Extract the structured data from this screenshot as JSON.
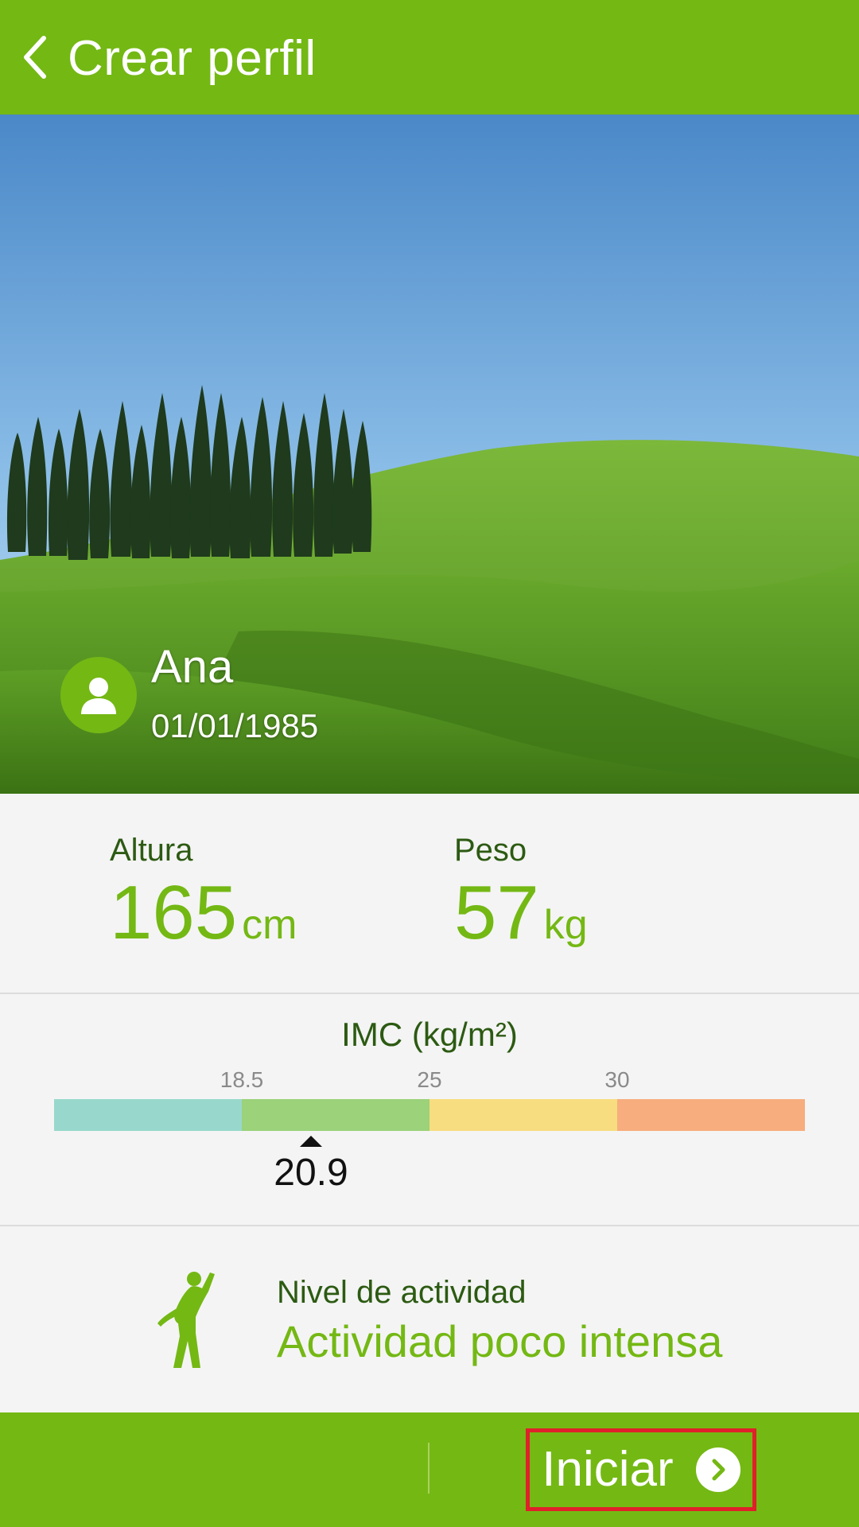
{
  "header": {
    "title": "Crear perfil",
    "back_icon": "chevron-left-icon"
  },
  "profile": {
    "name": "Ana",
    "birthdate": "01/01/1985",
    "avatar_icon": "user-silhouette-icon"
  },
  "measurements": {
    "height": {
      "label": "Altura",
      "value": "165",
      "unit": "cm"
    },
    "weight": {
      "label": "Peso",
      "value": "57",
      "unit": "kg"
    }
  },
  "bmi": {
    "title": "IMC (kg/m²)",
    "ticks": [
      "18.5",
      "25",
      "30"
    ],
    "value": "20.9",
    "segment_colors": [
      "#98d8cc",
      "#9bd27a",
      "#f7dd80",
      "#f7ad7e"
    ]
  },
  "activity": {
    "label": "Nivel de actividad",
    "value": "Actividad poco intensa",
    "icon": "stretching-person-icon"
  },
  "bottom_bar": {
    "start_label": "Iniciar",
    "start_icon": "chevron-right-circle-icon"
  },
  "colors": {
    "accent": "#74b814",
    "dark_green_text": "#2c5a12",
    "highlight_border": "#e0202a"
  }
}
